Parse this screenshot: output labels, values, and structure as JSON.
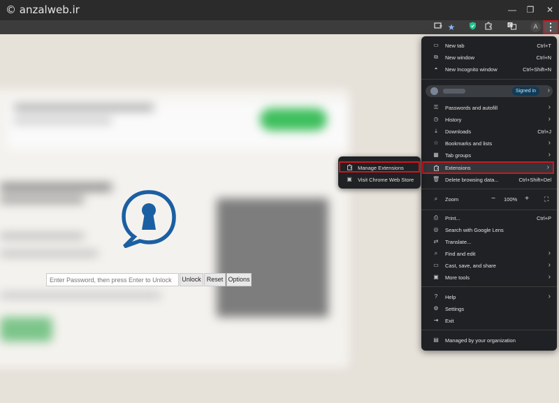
{
  "watermark": "© anzalweb.ir",
  "window_controls": {
    "minimize": "—",
    "restore": "❐",
    "close": "✕"
  },
  "toolbar": {
    "avatar_letter": "A",
    "menu_glyph": "⋮"
  },
  "lock_screen": {
    "password_placeholder": "Enter Password, then press Enter to Unlock",
    "unlock_label": "Unlock",
    "reset_label": "Reset",
    "options_label": "Options",
    "logo_color": "#1b5fa3"
  },
  "menu": {
    "new_tab": {
      "label": "New tab",
      "shortcut": "Ctrl+T"
    },
    "new_window": {
      "label": "New window",
      "shortcut": "Ctrl+N"
    },
    "incognito": {
      "label": "New Incognito window",
      "shortcut": "Ctrl+Shift+N"
    },
    "profile": {
      "signed_in": "Signed in"
    },
    "passwords": {
      "label": "Passwords and autofill"
    },
    "history": {
      "label": "History"
    },
    "downloads": {
      "label": "Downloads",
      "shortcut": "Ctrl+J"
    },
    "bookmarks": {
      "label": "Bookmarks and lists"
    },
    "tab_groups": {
      "label": "Tab groups"
    },
    "extensions": {
      "label": "Extensions"
    },
    "delete_data": {
      "label": "Delete browsing data...",
      "shortcut": "Ctrl+Shift+Del"
    },
    "zoom": {
      "label": "Zoom",
      "minus": "−",
      "value": "100%",
      "plus": "+"
    },
    "print": {
      "label": "Print...",
      "shortcut": "Ctrl+P"
    },
    "lens": {
      "label": "Search with Google Lens"
    },
    "translate": {
      "label": "Translate..."
    },
    "find_edit": {
      "label": "Find and edit"
    },
    "cast": {
      "label": "Cast, save, and share"
    },
    "more_tools": {
      "label": "More tools"
    },
    "help": {
      "label": "Help"
    },
    "settings": {
      "label": "Settings"
    },
    "exit": {
      "label": "Exit"
    },
    "managed": {
      "label": "Managed by your organization"
    }
  },
  "submenu": {
    "manage": {
      "label": "Manage Extensions"
    },
    "web_store": {
      "label": "Visit Chrome Web Store"
    }
  },
  "colors": {
    "highlight": "#d4141b",
    "menu_bg": "#202124",
    "signed_in_bg": "#103b57"
  }
}
